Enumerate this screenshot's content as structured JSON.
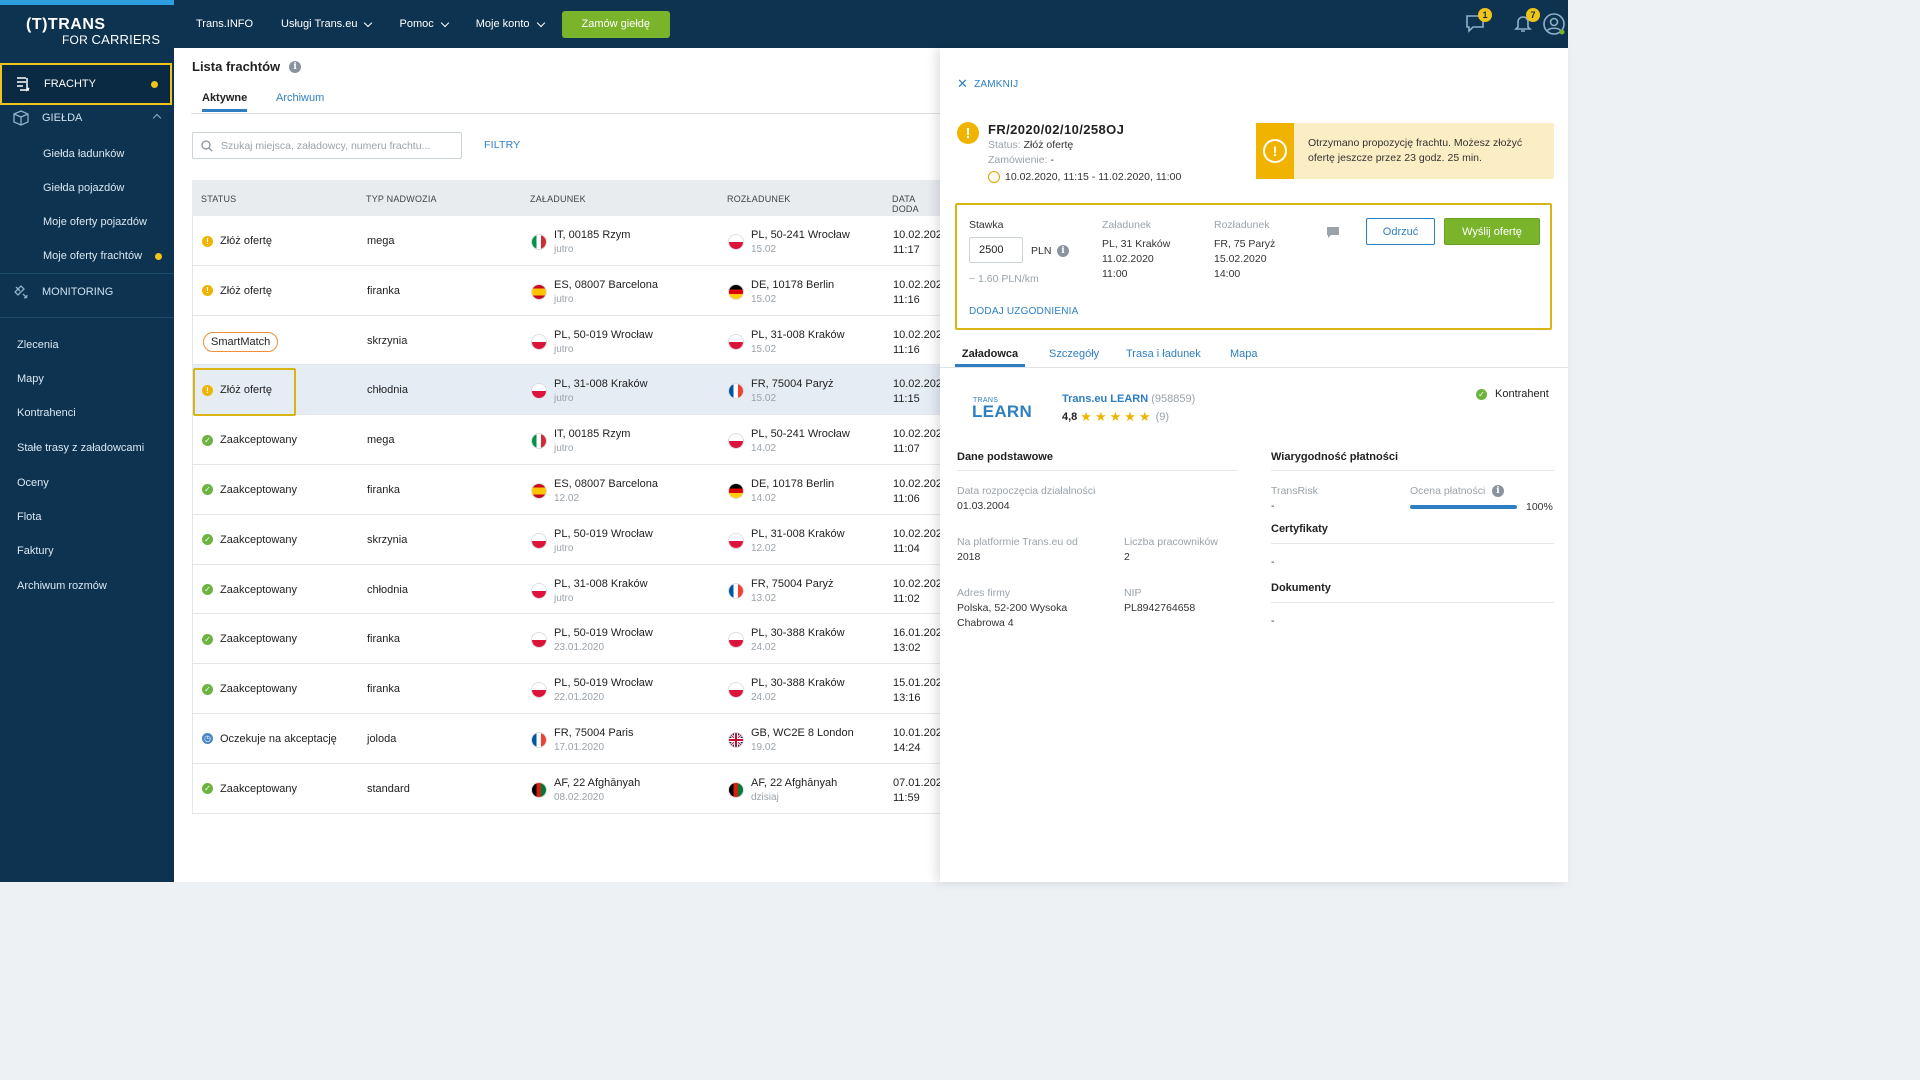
{
  "brand": {
    "line1": "(T)TRANS",
    "line2a": "FOR",
    "line2b": "CARRIERS"
  },
  "topnav": {
    "items": [
      {
        "label": "Trans.INFO",
        "dropdown": false
      },
      {
        "label": "Usługi Trans.eu",
        "dropdown": true
      },
      {
        "label": "Pomoc",
        "dropdown": true
      },
      {
        "label": "Moje konto",
        "dropdown": true
      }
    ],
    "cta": "Zamów giełdę",
    "chat_badge": "1",
    "bell_badge": "7"
  },
  "sidebar": {
    "frachty": "FRACHTY",
    "gielda": "GIEŁDA",
    "gielda_sub": [
      "Giełda ładunków",
      "Giełda pojazdów",
      "Moje oferty pojazdów",
      "Moje oferty frachtów"
    ],
    "monitoring": "MONITORING",
    "main": [
      "Zlecenia",
      "Mapy",
      "Kontrahenci",
      "Stałe trasy z załadowcami",
      "Oceny",
      "Flota",
      "Faktury",
      "Archiwum rozmów"
    ]
  },
  "list": {
    "title": "Lista frachtów",
    "tabs": [
      "Aktywne",
      "Archiwum"
    ],
    "search_placeholder": "Szukaj miejsca, załadowcy, numeru frachtu...",
    "filters": "FILTRY",
    "headers": [
      "STATUS",
      "TYP NADWOZIA",
      "ZAŁADUNEK",
      "ROZŁADUNEK",
      "DATA DODA"
    ],
    "rows": [
      {
        "status": "Złóż ofertę",
        "kind": "warn",
        "typ": "mega",
        "from": "IT, 00185 Rzym",
        "from_date": "jutro",
        "from_flag": "it",
        "to": "PL, 50-241 Wrocław",
        "to_date": "15.02",
        "to_flag": "pl",
        "d1": "10.02.202",
        "d2": "11:17"
      },
      {
        "status": "Złóż ofertę",
        "kind": "warn",
        "typ": "firanka",
        "from": "ES, 08007 Barcelona",
        "from_date": "jutro",
        "from_flag": "es",
        "to": "DE, 10178 Berlin",
        "to_date": "15.02",
        "to_flag": "de",
        "d1": "10.02.202",
        "d2": "11:16"
      },
      {
        "status": "SmartMatch",
        "kind": "smart",
        "typ": "skrzynia",
        "from": "PL, 50-019 Wrocław",
        "from_date": "jutro",
        "from_flag": "pl",
        "to": "PL, 31-008 Kraków",
        "to_date": "15.02",
        "to_flag": "pl",
        "d1": "10.02.202",
        "d2": "11:16"
      },
      {
        "status": "Złóż ofertę",
        "kind": "warn",
        "typ": "chłodnia",
        "from": "PL, 31-008 Kraków",
        "from_date": "jutro",
        "from_flag": "pl",
        "to": "FR, 75004 Paryż",
        "to_date": "15.02",
        "to_flag": "fr",
        "d1": "10.02.202",
        "d2": "11:15"
      },
      {
        "status": "Zaakceptowany",
        "kind": "ok",
        "typ": "mega",
        "from": "IT, 00185 Rzym",
        "from_date": "jutro",
        "from_flag": "it",
        "to": "PL, 50-241 Wrocław",
        "to_date": "14.02",
        "to_flag": "pl",
        "d1": "10.02.202",
        "d2": "11:07"
      },
      {
        "status": "Zaakceptowany",
        "kind": "ok",
        "typ": "firanka",
        "from": "ES, 08007 Barcelona",
        "from_date": "12.02",
        "from_flag": "es",
        "to": "DE, 10178 Berlin",
        "to_date": "14.02",
        "to_flag": "de",
        "d1": "10.02.202",
        "d2": "11:06"
      },
      {
        "status": "Zaakceptowany",
        "kind": "ok",
        "typ": "skrzynia",
        "from": "PL, 50-019 Wrocław",
        "from_date": "jutro",
        "from_flag": "pl",
        "to": "PL, 31-008 Kraków",
        "to_date": "12.02",
        "to_flag": "pl",
        "d1": "10.02.202",
        "d2": "11:04"
      },
      {
        "status": "Zaakceptowany",
        "kind": "ok",
        "typ": "chłodnia",
        "from": "PL, 31-008 Kraków",
        "from_date": "jutro",
        "from_flag": "pl",
        "to": "FR, 75004 Paryż",
        "to_date": "13.02",
        "to_flag": "fr",
        "d1": "10.02.202",
        "d2": "11:02"
      },
      {
        "status": "Zaakceptowany",
        "kind": "ok",
        "typ": "firanka",
        "from": "PL, 50-019 Wrocław",
        "from_date": "23.01.2020",
        "from_flag": "pl",
        "to": "PL, 30-388 Kraków",
        "to_date": "24.02",
        "to_flag": "pl",
        "d1": "16.01.202",
        "d2": "13:02"
      },
      {
        "status": "Zaakceptowany",
        "kind": "ok",
        "typ": "firanka",
        "from": "PL, 50-019 Wrocław",
        "from_date": "22.01.2020",
        "from_flag": "pl",
        "to": "PL, 30-388 Kraków",
        "to_date": "24.02",
        "to_flag": "pl",
        "d1": "15.01.202",
        "d2": "13:16"
      },
      {
        "status": "Oczekuje na akceptację",
        "kind": "wait",
        "typ": "joloda",
        "from": "FR, 75004 Paris",
        "from_date": "17.01.2020",
        "from_flag": "fr",
        "to": "GB, WC2E 8 London",
        "to_date": "19.02",
        "to_flag": "gb",
        "d1": "10.01.202",
        "d2": "14:24"
      },
      {
        "status": "Zaakceptowany",
        "kind": "ok",
        "typ": "standard",
        "from": "AF, 22 Afghānyah",
        "from_date": "08.02.2020",
        "from_flag": "af",
        "to": "AF, 22 Afghānyah",
        "to_date": "dzisiaj",
        "to_flag": "af",
        "d1": "07.01.202",
        "d2": "11:59"
      }
    ]
  },
  "panel": {
    "close": "ZAMKNIJ",
    "number": "FR/2020/02/10/258OJ",
    "status_label": "Status:",
    "status_value": "Złóż ofertę",
    "order_label": "Zamówienie:",
    "order_value": "-",
    "dates": "10.02.2020, 11:15 - 11.02.2020, 11:00",
    "notice": "Otrzymano propozycję frachtu. Możesz złożyć ofertę jeszcze przez 23 godz. 25 min.",
    "offer": {
      "rate_label": "Stawka",
      "rate_value": "2500",
      "currency": "PLN",
      "per_km": "~ 1.60 PLN/km",
      "load_label": "Załadunek",
      "load_place": "PL, 31 Kraków",
      "load_date": "11.02.2020",
      "load_time": "11:00",
      "unload_label": "Rozładunek",
      "unload_place": "FR, 75 Paryż",
      "unload_date": "15.02.2020",
      "unload_time": "14:00",
      "reject": "Odrzuć",
      "send": "Wyślij ofertę",
      "add": "DODAJ UZGODNIENIA"
    },
    "tabs": [
      "Załadowca",
      "Szczegóły",
      "Trasa i ładunek",
      "Mapa"
    ],
    "company": {
      "logo_small": "TRANS",
      "logo_big": "LEARN",
      "name": "Trans.eu LEARN",
      "id": "(958859)",
      "rating": "4,8",
      "rating_count": "(9)",
      "badge": "Kontrahent"
    },
    "basic": {
      "title": "Dane podstawowe",
      "start_label": "Data rozpoczęcia działalności",
      "start_value": "01.03.2004",
      "platform_label": "Na platformie Trans.eu od",
      "platform_value": "2018",
      "employees_label": "Liczba pracowników",
      "employees_value": "2",
      "address_label": "Adres firmy",
      "address_line1": "Polska, 52-200 Wysoka",
      "address_line2": "Chabrowa 4",
      "nip_label": "NIP",
      "nip_value": "PL8942764658"
    },
    "payment": {
      "title": "Wiarygodność płatności",
      "transrisk_label": "TransRisk",
      "transrisk_value": "-",
      "score_label": "Ocena płatności",
      "score_value": "100%",
      "score_fraction": 1.0
    },
    "certs": {
      "title": "Certyfikaty",
      "value": "-"
    },
    "docs": {
      "title": "Dokumenty",
      "value": "-"
    }
  },
  "colors": {
    "navy": "#0d3350",
    "accent_blue": "#2e7fc2",
    "green": "#7ab42a",
    "yellow": "#f0c419"
  }
}
